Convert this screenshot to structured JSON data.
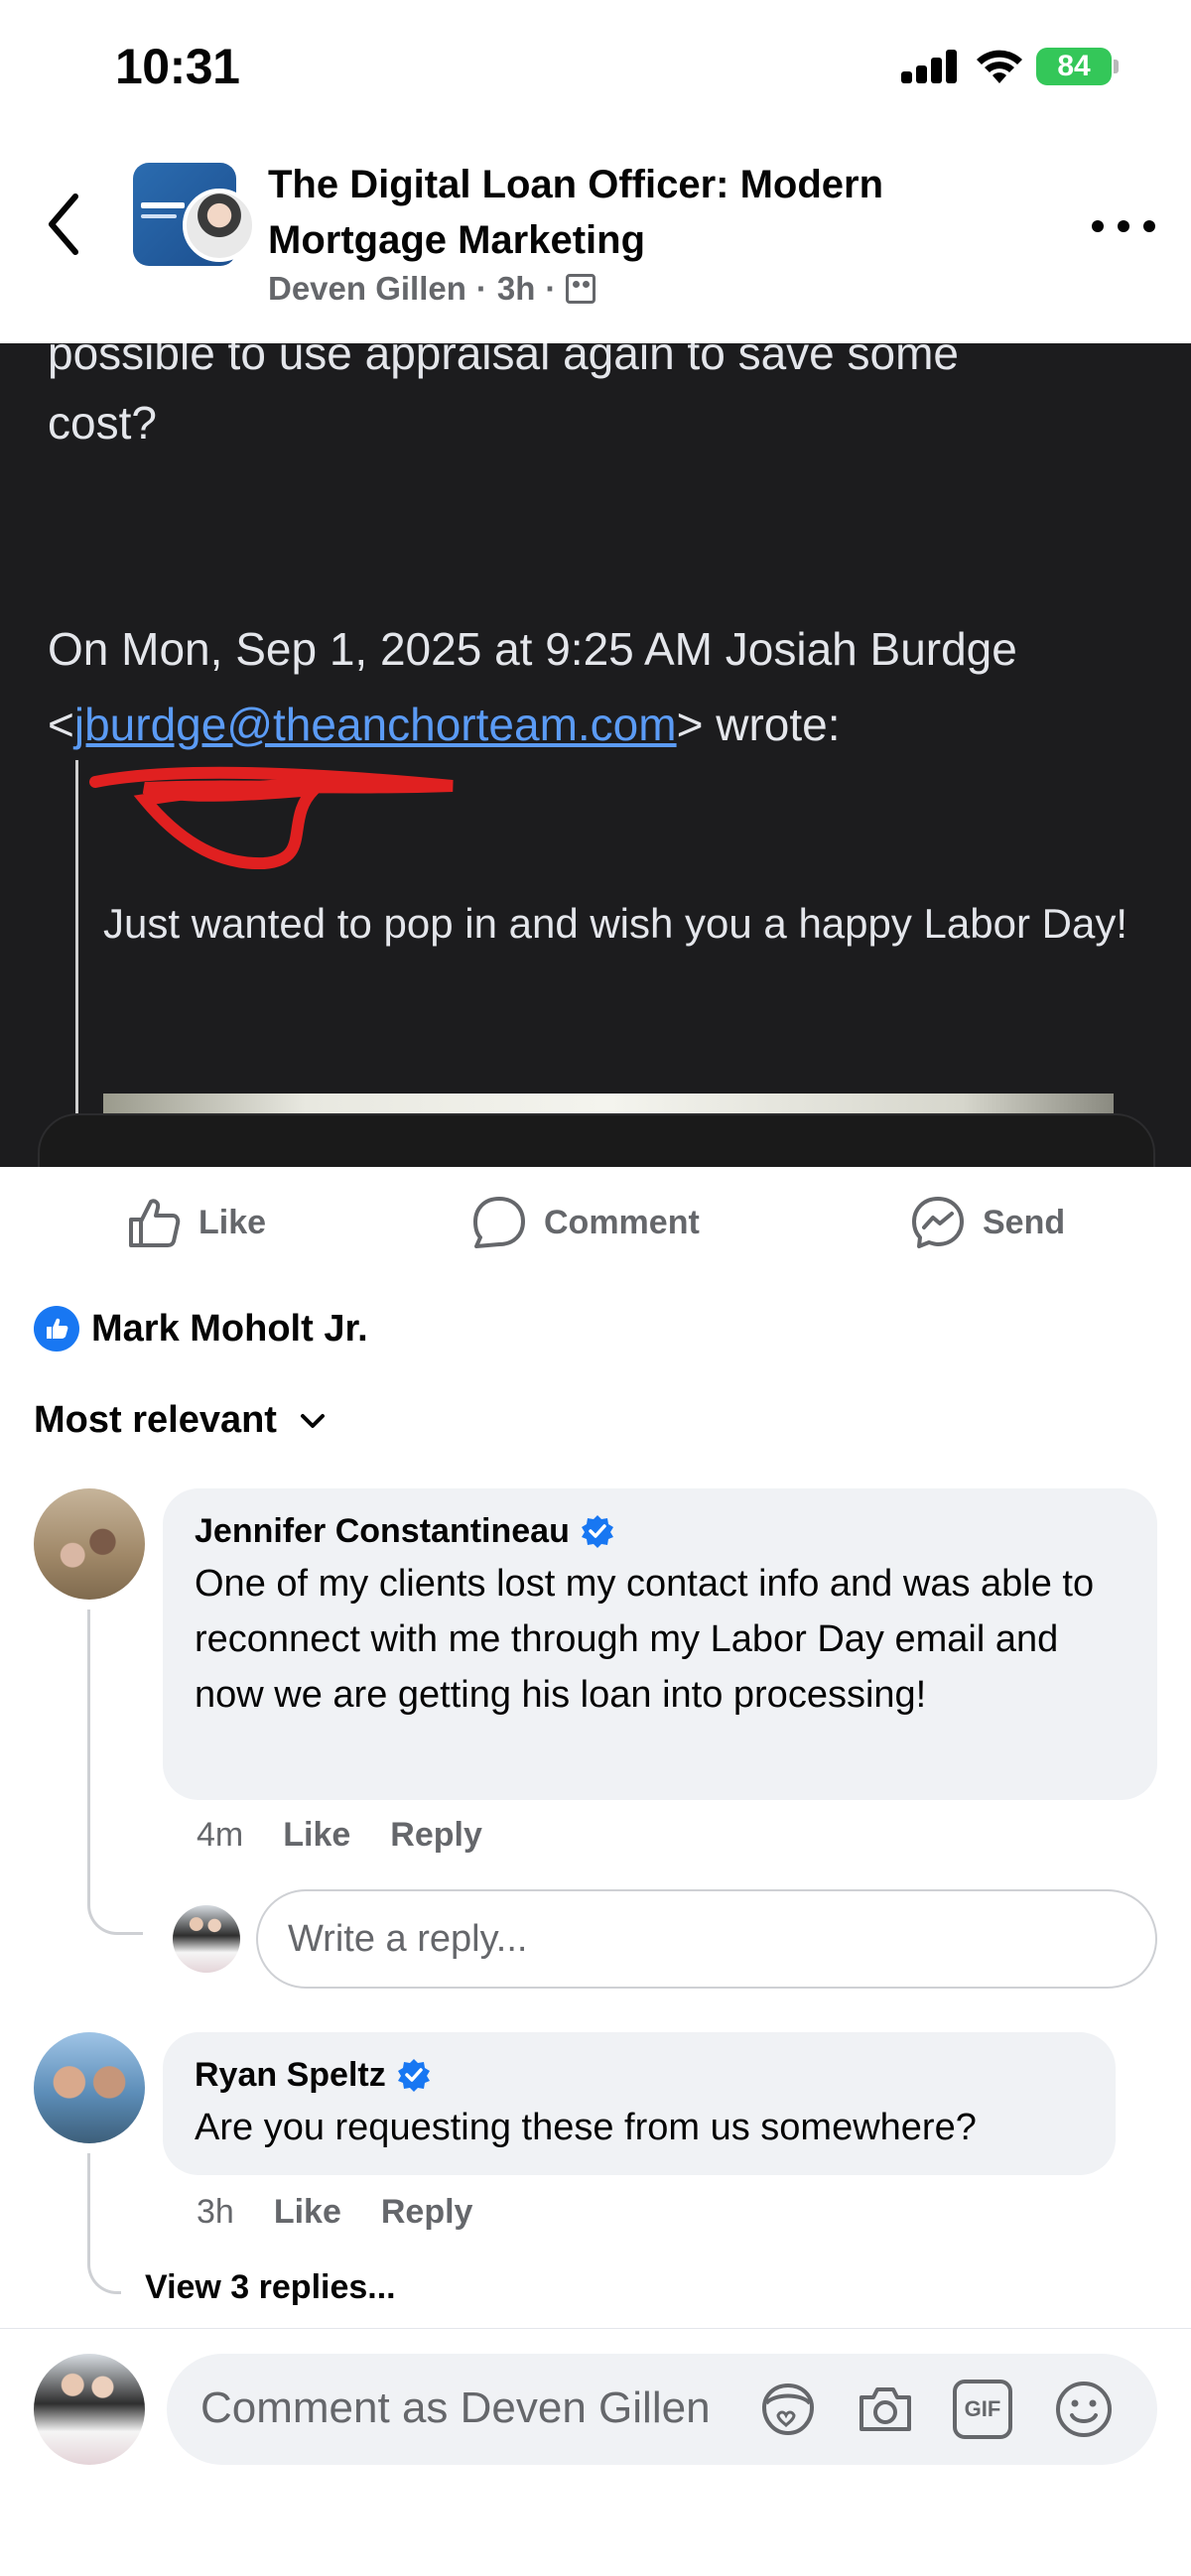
{
  "status_bar": {
    "time": "10:31",
    "battery": "84"
  },
  "header": {
    "title": "The Digital Loan Officer: Modern Mortgage Marketing",
    "author": "Deven Gillen",
    "time_ago": "3h",
    "separator": "·"
  },
  "post_image": {
    "cut_line": "possible to use appraisal again to save some",
    "line1": "cost?",
    "line2": "On Mon, Sep 1, 2025 at 9:25 AM Josiah Burdge",
    "email_open": "<",
    "email": "jburdge@theanchorteam.com",
    "email_close": "> wrote:",
    "quote": "Just wanted to pop in and wish you a happy Labor Day!"
  },
  "actions": {
    "like": "Like",
    "comment": "Comment",
    "send": "Send"
  },
  "reactions": {
    "names": "Mark Moholt Jr."
  },
  "sort": {
    "label": "Most relevant"
  },
  "comments": [
    {
      "author": "Jennifer Constantineau",
      "text": "One of my clients lost my contact info and was able to reconnect with me through my Labor Day email and now we are getting his loan into processing!",
      "time": "4m",
      "like": "Like",
      "reply": "Reply",
      "reply_placeholder": "Write a reply..."
    },
    {
      "author": "Ryan Speltz",
      "text": "Are you requesting these from us somewhere?",
      "time": "3h",
      "like": "Like",
      "reply": "Reply",
      "view_replies": "View 3 replies..."
    }
  ],
  "composer": {
    "placeholder": "Comment as Deven Gillen",
    "gif": "GIF"
  },
  "colors": {
    "accent": "#1877f2",
    "secondary_text": "#65676b",
    "bubble": "#f0f2f5",
    "dark_bg": "#1c1c1e",
    "battery": "#34c759",
    "link": "#5b9bf5",
    "redaction": "#e02020"
  },
  "icons": [
    "back-arrow-icon",
    "more-icon",
    "members-icon",
    "like-icon",
    "comment-icon",
    "messenger-icon",
    "like-reaction-icon",
    "chevron-down-icon",
    "verified-icon",
    "avatar-sticker-icon",
    "camera-icon",
    "gif-icon",
    "emoji-icon"
  ]
}
